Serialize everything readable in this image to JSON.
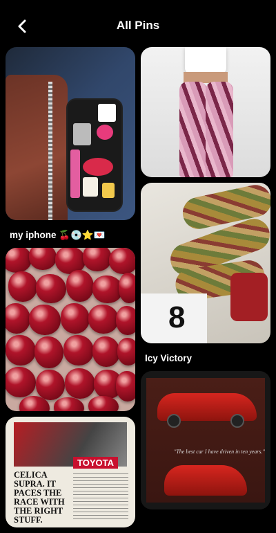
{
  "header": {
    "title": "All Pins",
    "back_icon": "chevron-left-icon"
  },
  "pins_left": [
    {
      "caption": "my iphone 🍒💿⭐💌",
      "alt": "phone"
    },
    {
      "caption": "",
      "alt": "pomegranate"
    },
    {
      "caption": "",
      "alt": "toyota-ad"
    }
  ],
  "pins_right": [
    {
      "caption": "",
      "alt": "pants"
    },
    {
      "caption": "Icy Victory",
      "alt": "legs"
    },
    {
      "caption": "",
      "alt": "car-ad"
    }
  ],
  "ad_texts": {
    "toyota_brand": "TOYOTA",
    "toyota_headline": "CELICA SUPRA. IT PACES THE RACE WITH THE RIGHT STUFF.",
    "car_quote": "\"The best car I have driven in ten years.\""
  },
  "colors": {
    "background": "#000000",
    "text": "#ffffff"
  }
}
